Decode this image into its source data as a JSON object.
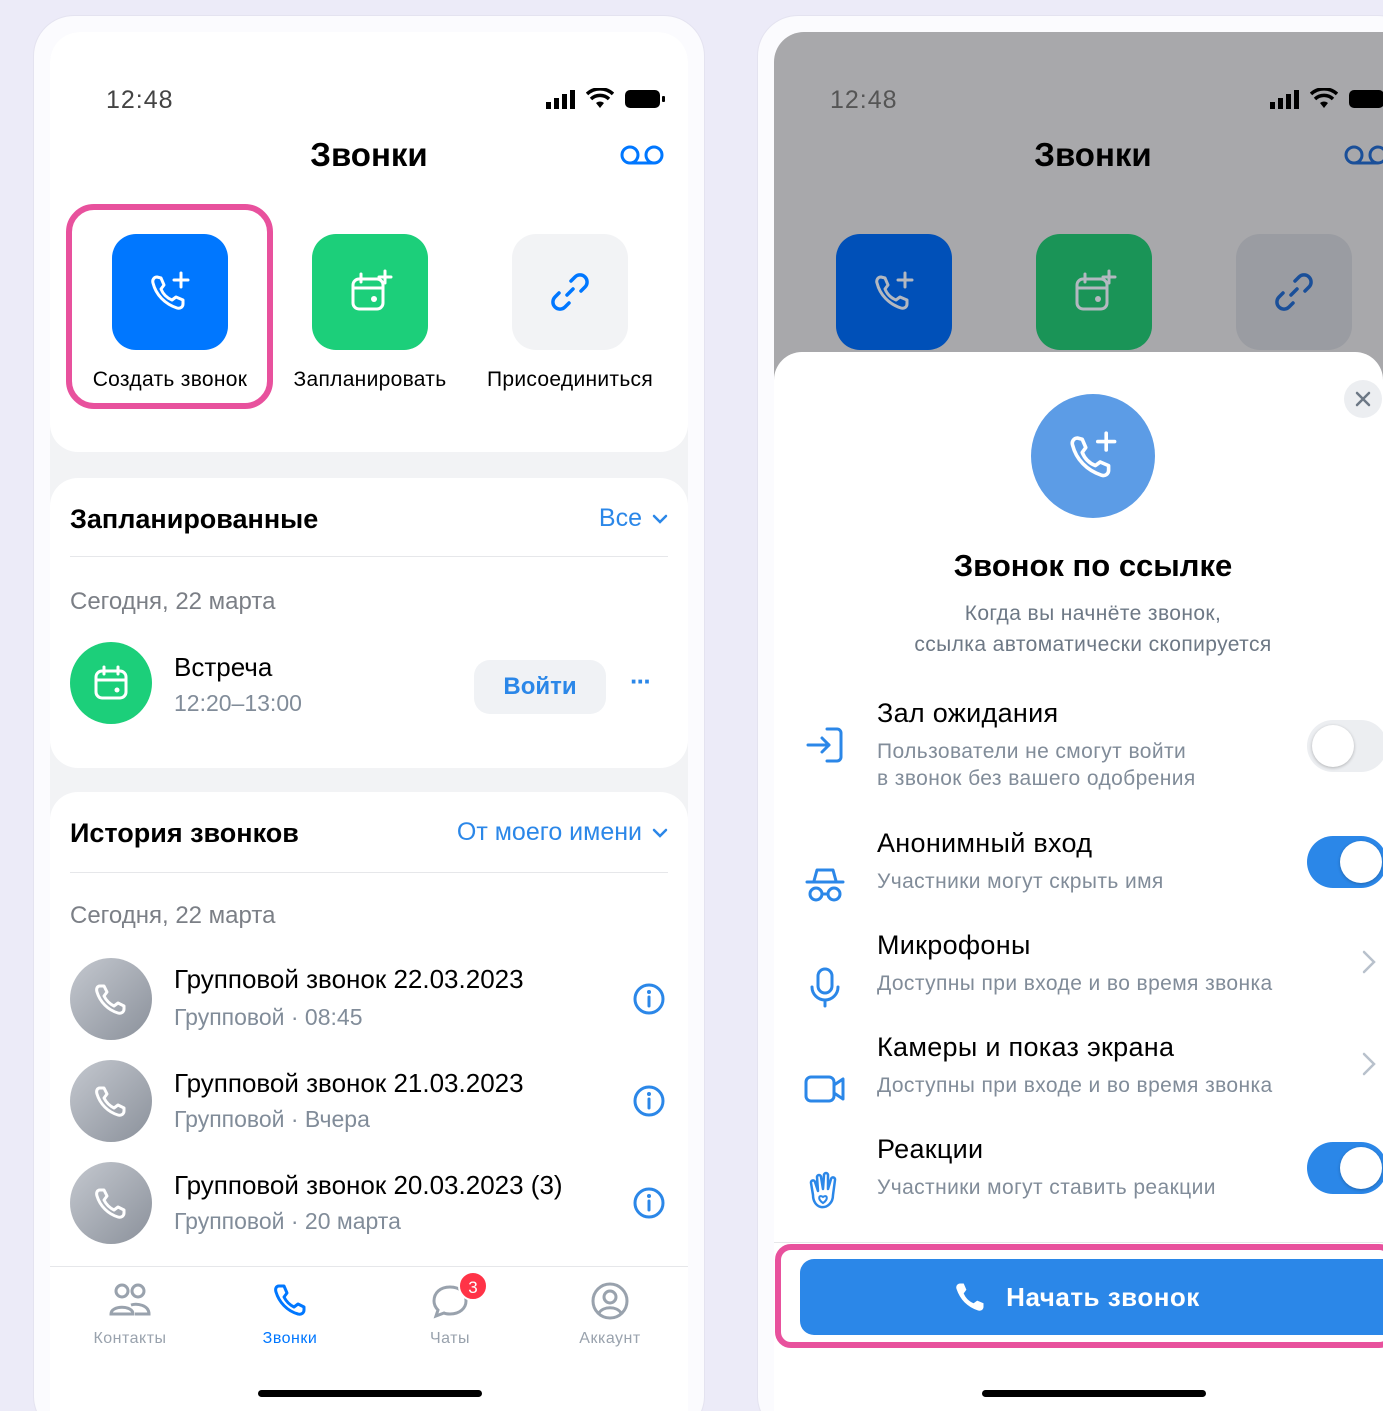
{
  "left": {
    "status_time": "12:48",
    "title": "Звонки",
    "actions": [
      {
        "label": "Создать звонок"
      },
      {
        "label": "Запланировать"
      },
      {
        "label": "Присоединиться"
      }
    ],
    "scheduled": {
      "title": "Запланированные",
      "filter": "Все",
      "date": "Сегодня, 22 марта",
      "event": {
        "title": "Встреча",
        "time": "12:20–13:00",
        "join_label": "Войти",
        "more": "···"
      }
    },
    "history": {
      "title": "История звонков",
      "filter": "От моего имени",
      "date": "Сегодня, 22 марта",
      "items": [
        {
          "title": "Групповой звонок 22.03.2023",
          "sub": "Групповой · 08:45"
        },
        {
          "title": "Групповой звонок 21.03.2023",
          "sub": "Групповой · Вчера"
        },
        {
          "title": "Групповой звонок 20.03.2023 (3)",
          "sub": "Групповой · 20 марта"
        }
      ]
    },
    "tabs": [
      {
        "label": "Контакты"
      },
      {
        "label": "Звонки"
      },
      {
        "label": "Чаты",
        "badge": "3"
      },
      {
        "label": "Аккаунт"
      }
    ]
  },
  "right": {
    "status_time": "12:48",
    "title": "Звонки",
    "sheet": {
      "title": "Звонок по ссылке",
      "subtitle_line1": "Когда вы начнёте звонок,",
      "subtitle_line2": "ссылка автоматически скопируется",
      "options": [
        {
          "title": "Зал ожидания",
          "sub1": "Пользователи не смогут войти",
          "sub2": "в звонок без вашего одобрения",
          "toggle_on": false
        },
        {
          "title": "Анонимный вход",
          "sub1": "Участники могут скрыть имя",
          "toggle_on": true
        },
        {
          "title": "Микрофоны",
          "sub1": "Доступны при входе и во время звонка"
        },
        {
          "title": "Камеры и показ экрана",
          "sub1": "Доступны при входе и во время звонка"
        },
        {
          "title": "Реакции",
          "sub1": "Участники могут ставить реакции",
          "toggle_on": true
        }
      ],
      "start_label": "Начать звонок"
    }
  },
  "colors": {
    "accent": "#0077ff",
    "green": "#1ccf7a",
    "highlight": "#e8519d",
    "link": "#2b87e8"
  }
}
